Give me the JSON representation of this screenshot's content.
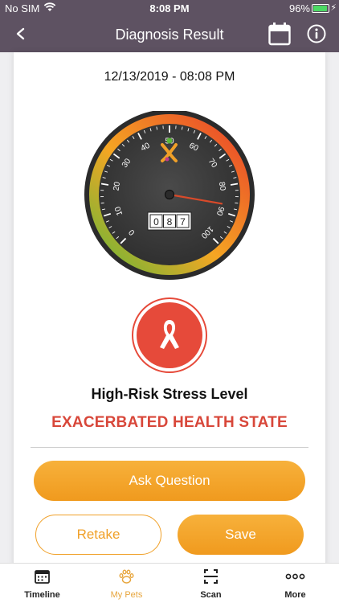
{
  "status_bar": {
    "carrier": "No SIM",
    "time": "8:08 PM",
    "battery": "96%"
  },
  "nav": {
    "title": "Diagnosis Result",
    "back_icon": "chevron-left-icon",
    "calendar_icon": "calendar-icon",
    "info_icon": "info-icon"
  },
  "result": {
    "datetime": "12/13/2019 - 08:08 PM",
    "gauge": {
      "value": 87,
      "min": 0,
      "max": 100,
      "tick_labels": [
        "0",
        "10",
        "20",
        "30",
        "40",
        "50",
        "60",
        "70",
        "80",
        "90",
        "100"
      ],
      "digits": [
        "0",
        "8",
        "7"
      ],
      "colors": {
        "low": "#5cb83a",
        "mid": "#f5a623",
        "high": "#e83a2a",
        "needle": "#d94a2a",
        "dial": "#3a3a3a"
      }
    },
    "risk_icon": "awareness-ribbon-icon",
    "risk_level": "High-Risk Stress Level",
    "health_state": "EXACERBATED HEALTH STATE"
  },
  "actions": {
    "ask": "Ask Question",
    "retake": "Retake",
    "save": "Save"
  },
  "tabs": [
    {
      "label": "Timeline",
      "icon": "calendar-icon",
      "active": false
    },
    {
      "label": "My Pets",
      "icon": "paw-icon",
      "active": true
    },
    {
      "label": "Scan",
      "icon": "scan-icon",
      "active": false
    },
    {
      "label": "More",
      "icon": "more-dots-icon",
      "active": false
    }
  ],
  "colors": {
    "header": "#5e5262",
    "accent": "#f0a028",
    "danger": "#d8473a"
  }
}
